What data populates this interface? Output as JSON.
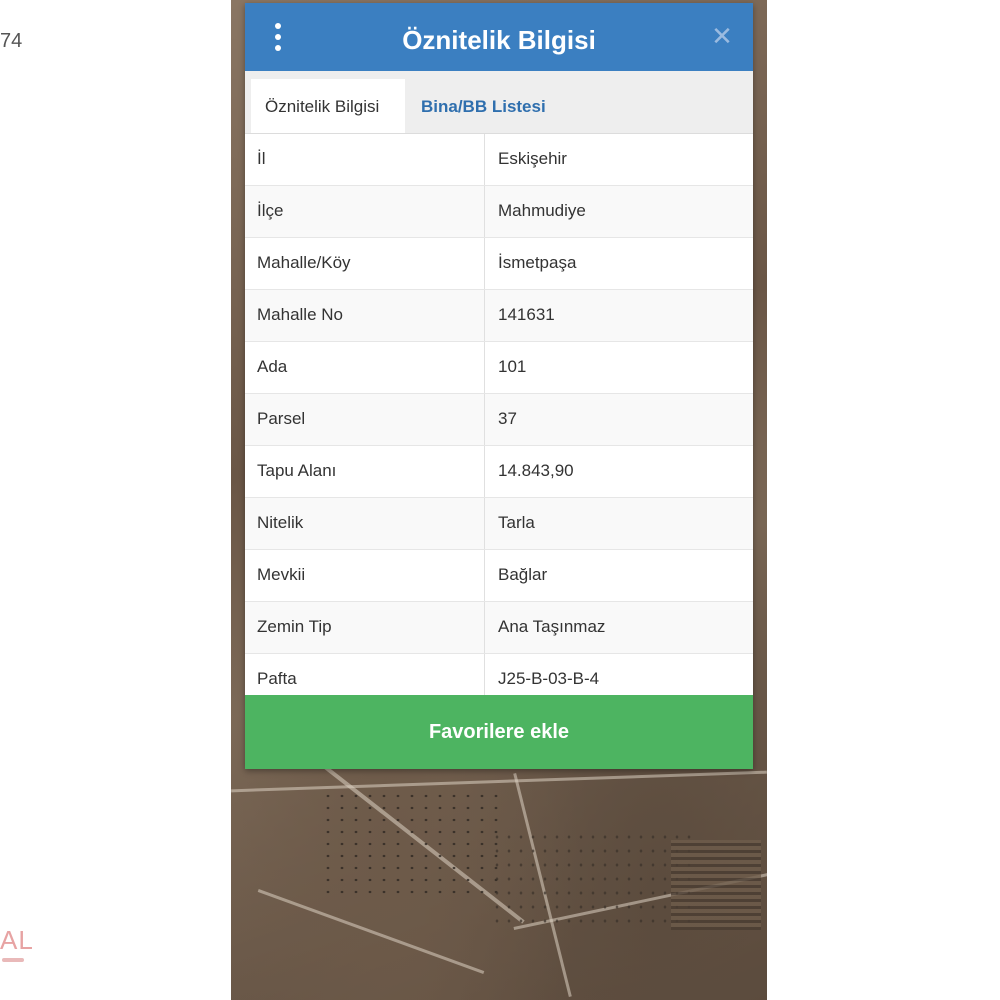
{
  "background": {
    "left_edge_text": "74",
    "left_logo_text": "AL"
  },
  "dialog": {
    "title": "Öznitelik Bilgisi",
    "menu_icon": "kebab-menu-icon",
    "close_icon": "close-icon",
    "tabs": [
      {
        "label": "Öznitelik Bilgisi",
        "active": true
      },
      {
        "label": "Bina/BB Listesi",
        "active": false
      }
    ],
    "rows": [
      {
        "label": "İl",
        "value": "Eskişehir"
      },
      {
        "label": "İlçe",
        "value": "Mahmudiye"
      },
      {
        "label": "Mahalle/Köy",
        "value": "İsmetpaşa"
      },
      {
        "label": "Mahalle No",
        "value": "141631"
      },
      {
        "label": "Ada",
        "value": "101"
      },
      {
        "label": "Parsel",
        "value": "37"
      },
      {
        "label": "Tapu Alanı",
        "value": "14.843,90"
      },
      {
        "label": "Nitelik",
        "value": "Tarla"
      },
      {
        "label": "Mevkii",
        "value": "Bağlar"
      },
      {
        "label": "Zemin Tip",
        "value": "Ana Taşınmaz"
      },
      {
        "label": "Pafta",
        "value": "J25-B-03-B-4"
      }
    ],
    "favorite_button": "Favorilere ekle"
  },
  "colors": {
    "header": "#3b7fc1",
    "button": "#4db461",
    "tab_link": "#2f6fae"
  }
}
